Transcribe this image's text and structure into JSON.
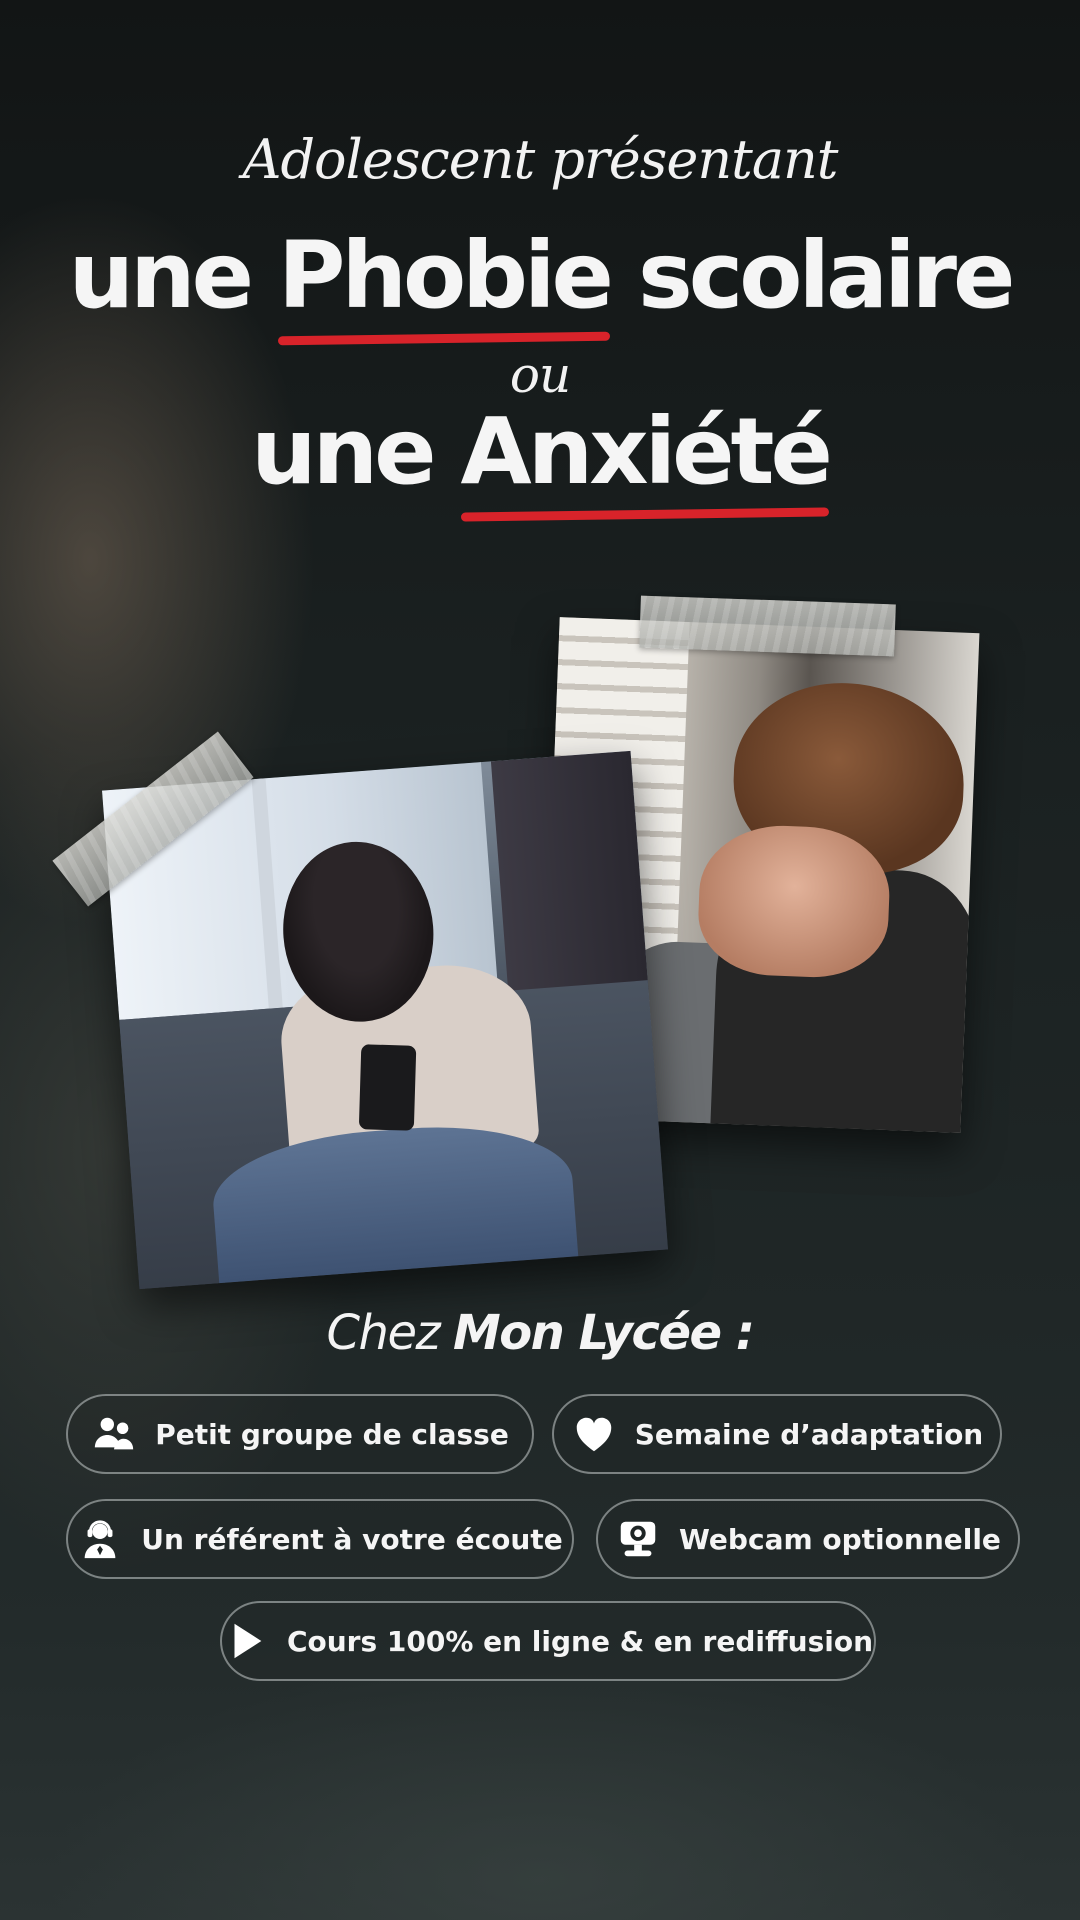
{
  "headline": {
    "intro": "Adolescent présentant",
    "line1_prefix": "une",
    "line1_emphasis": "Phobie",
    "line1_suffix": "scolaire",
    "connector": "ou",
    "line2_prefix": "une",
    "line2_emphasis": "Anxiété"
  },
  "colors": {
    "accent_underline": "#d8232a",
    "background": "#1e2525",
    "text": "#ffffff"
  },
  "photos": [
    {
      "subject": "teen-boy-holding-head"
    },
    {
      "subject": "teen-girl-on-sofa-with-phone"
    }
  ],
  "section": {
    "title_prefix": "Chez",
    "title_brand": "Mon Lycée :"
  },
  "features": [
    {
      "icon": "users-icon",
      "label": "Petit groupe de classe"
    },
    {
      "icon": "heart-icon",
      "label": "Semaine d’adaptation"
    },
    {
      "icon": "headset-user-icon",
      "label": "Un référent à votre écoute"
    },
    {
      "icon": "webcam-icon",
      "label": "Webcam optionnelle"
    },
    {
      "icon": "play-icon",
      "label": "Cours 100% en ligne & en rediffusion"
    }
  ]
}
